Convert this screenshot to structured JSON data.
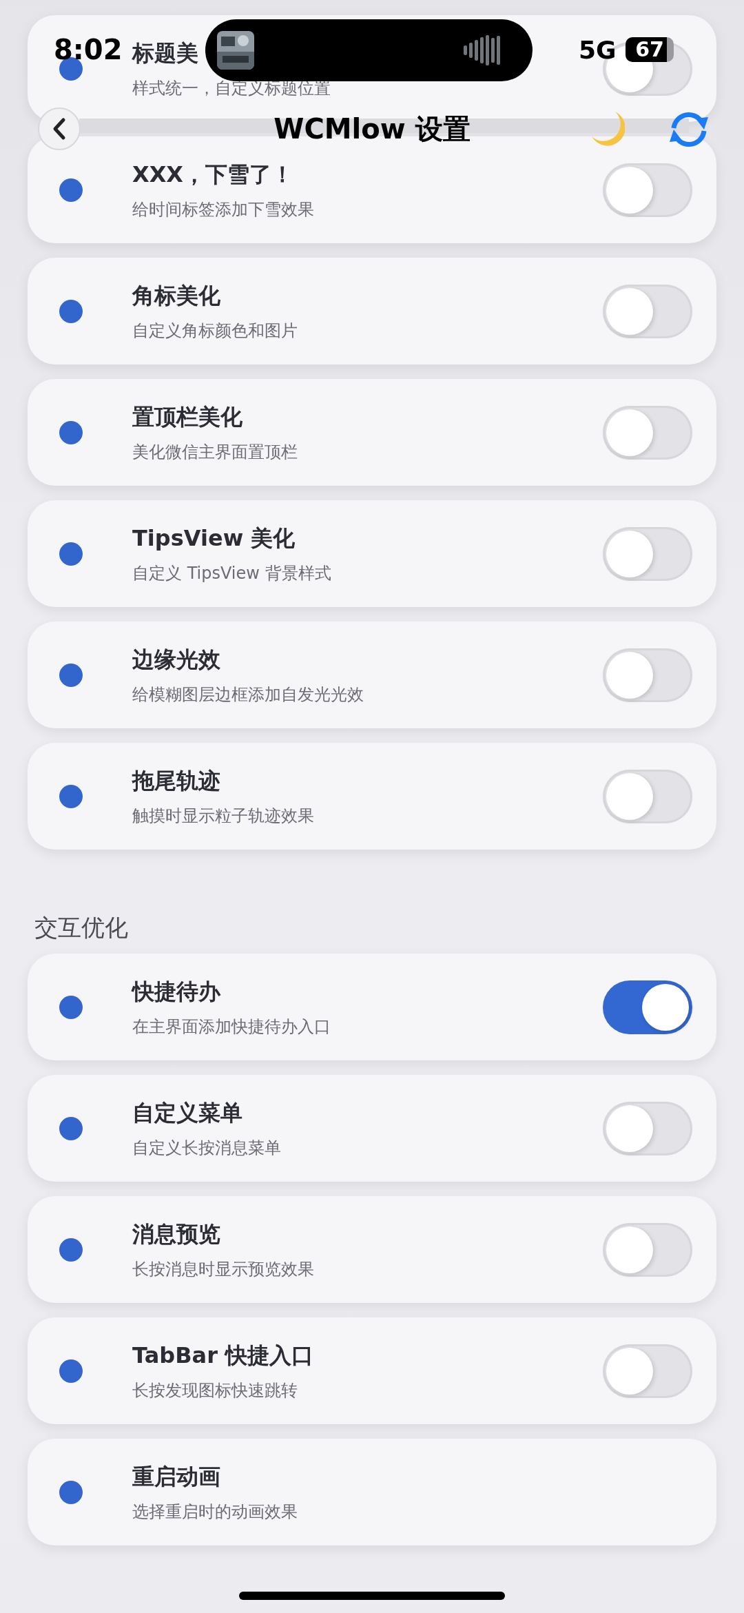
{
  "status_bar": {
    "time": "8:02",
    "network": "5G",
    "battery": "67"
  },
  "nav": {
    "title": "WCMlow 设置"
  },
  "groups": [
    {
      "items": [
        {
          "title": "标题美",
          "subtitle": "样式统一，自定义标题位置",
          "kind": "toggle",
          "on": false
        },
        {
          "title": "XXX，下雪了！",
          "subtitle": "给时间标签添加下雪效果",
          "kind": "toggle",
          "on": false
        },
        {
          "title": "角标美化",
          "subtitle": "自定义角标颜色和图片",
          "kind": "toggle",
          "on": false
        },
        {
          "title": "置顶栏美化",
          "subtitle": "美化微信主界面置顶栏",
          "kind": "toggle",
          "on": false
        },
        {
          "title": "TipsView 美化",
          "subtitle": "自定义 TipsView 背景样式",
          "kind": "toggle",
          "on": false
        },
        {
          "title": "边缘光效",
          "subtitle": "给模糊图层边框添加自发光光效",
          "kind": "toggle",
          "on": false
        },
        {
          "title": "拖尾轨迹",
          "subtitle": "触摸时显示粒子轨迹效果",
          "kind": "toggle",
          "on": false
        }
      ]
    },
    {
      "title": "交互优化",
      "items": [
        {
          "title": "快捷待办",
          "subtitle": "在主界面添加快捷待办入口",
          "kind": "toggle",
          "on": true
        },
        {
          "title": "自定义菜单",
          "subtitle": "自定义长按消息菜单",
          "kind": "toggle",
          "on": false
        },
        {
          "title": "消息预览",
          "subtitle": "长按消息时显示预览效果",
          "kind": "toggle",
          "on": false
        },
        {
          "title": "TabBar 快捷入口",
          "subtitle": "长按发现图标快速跳转",
          "kind": "toggle",
          "on": false
        },
        {
          "title": "重启动画",
          "subtitle": "选择重启时的动画效果",
          "kind": "link"
        }
      ]
    }
  ]
}
